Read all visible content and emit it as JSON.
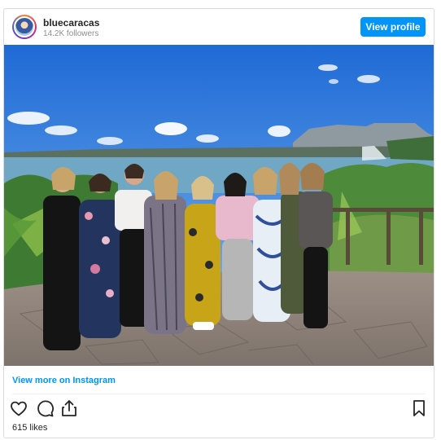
{
  "header": {
    "username": "bluecaracas",
    "followers": "14.2K followers",
    "view_profile_label": "View profile"
  },
  "footer": {
    "view_more_label": "View more on Instagram",
    "likes": "615 likes"
  },
  "icons": [
    "heart-icon",
    "comment-icon",
    "share-icon",
    "bookmark-icon"
  ],
  "colors": {
    "accent": "#0095f6",
    "text": "#262626",
    "muted": "#8e8e8e"
  }
}
